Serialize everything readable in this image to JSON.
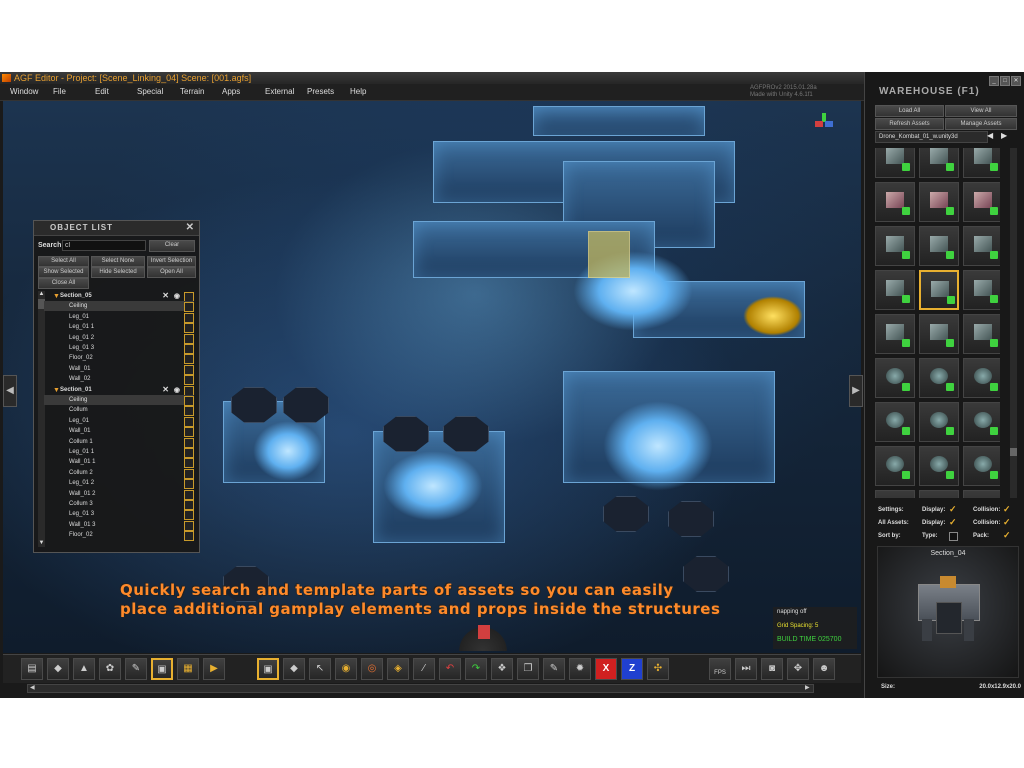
{
  "window": {
    "title": "AGF Editor - Project: [Scene_Linking_04] Scene: [001.agfs]",
    "version_lines": [
      "AGFPROv2 2015.01.28a",
      "Made with Unity 4.6.1f1"
    ]
  },
  "menu": [
    "Window",
    "File",
    "Edit",
    "Special",
    "Terrain",
    "Apps",
    "External",
    "Presets",
    "Help"
  ],
  "object_list": {
    "title": "OBJECT LIST",
    "search_label": "Search:",
    "search_value": "cl",
    "clear_label": "Clear",
    "buttons": [
      "Select All",
      "Select None",
      "Invert Selection",
      "Show Selected",
      "Hide Selected",
      "Open All",
      "Close All"
    ],
    "rows": [
      {
        "label": "Section_05",
        "section": true
      },
      {
        "label": "Ceiling",
        "selected": true
      },
      {
        "label": "Leg_01"
      },
      {
        "label": "Leg_01 1"
      },
      {
        "label": "Leg_01 2"
      },
      {
        "label": "Leg_01 3"
      },
      {
        "label": "Floor_02"
      },
      {
        "label": "Wall_01"
      },
      {
        "label": "Wall_02"
      },
      {
        "label": "Section_01",
        "section": true
      },
      {
        "label": "Ceiling",
        "selected": true
      },
      {
        "label": "Collum"
      },
      {
        "label": "Leg_01"
      },
      {
        "label": "Wall_01"
      },
      {
        "label": "Collum 1"
      },
      {
        "label": "Leg_01 1"
      },
      {
        "label": "Wall_01 1"
      },
      {
        "label": "Collum 2"
      },
      {
        "label": "Leg_01 2"
      },
      {
        "label": "Wall_01 2"
      },
      {
        "label": "Collum 3"
      },
      {
        "label": "Leg_01 3"
      },
      {
        "label": "Wall_01 3"
      },
      {
        "label": "Floor_02"
      }
    ]
  },
  "caption": {
    "line1": "Quickly search and template parts of assets so you can easily",
    "line2": "place additional gamplay elements and props inside the structures"
  },
  "snap": {
    "snapping": "napping off",
    "grid_spacing": "Grid Spacing: 5",
    "build_time": "BUILD TIME 025700"
  },
  "toolbar": {
    "fps_label": "FPS",
    "x_label": "X",
    "z_label": "Z"
  },
  "warehouse": {
    "title": "WAREHOUSE (F1)",
    "buttons": {
      "load_all": "Load All",
      "view_all": "View All",
      "refresh": "Refresh Assets",
      "manage": "Manage Assets"
    },
    "current_file": "Drone_Kombat_01_w.unity3d",
    "settings": {
      "settings_label": "Settings:",
      "all_assets_label": "All Assets:",
      "sort_label": "Sort by:",
      "display_label": "Display:",
      "collision_label": "Collision:",
      "type_label": "Type:",
      "pack_label": "Pack:"
    },
    "preview_title": "Section_04",
    "size_label": "Size:",
    "size_value": "20.0x12.9x20.0"
  }
}
